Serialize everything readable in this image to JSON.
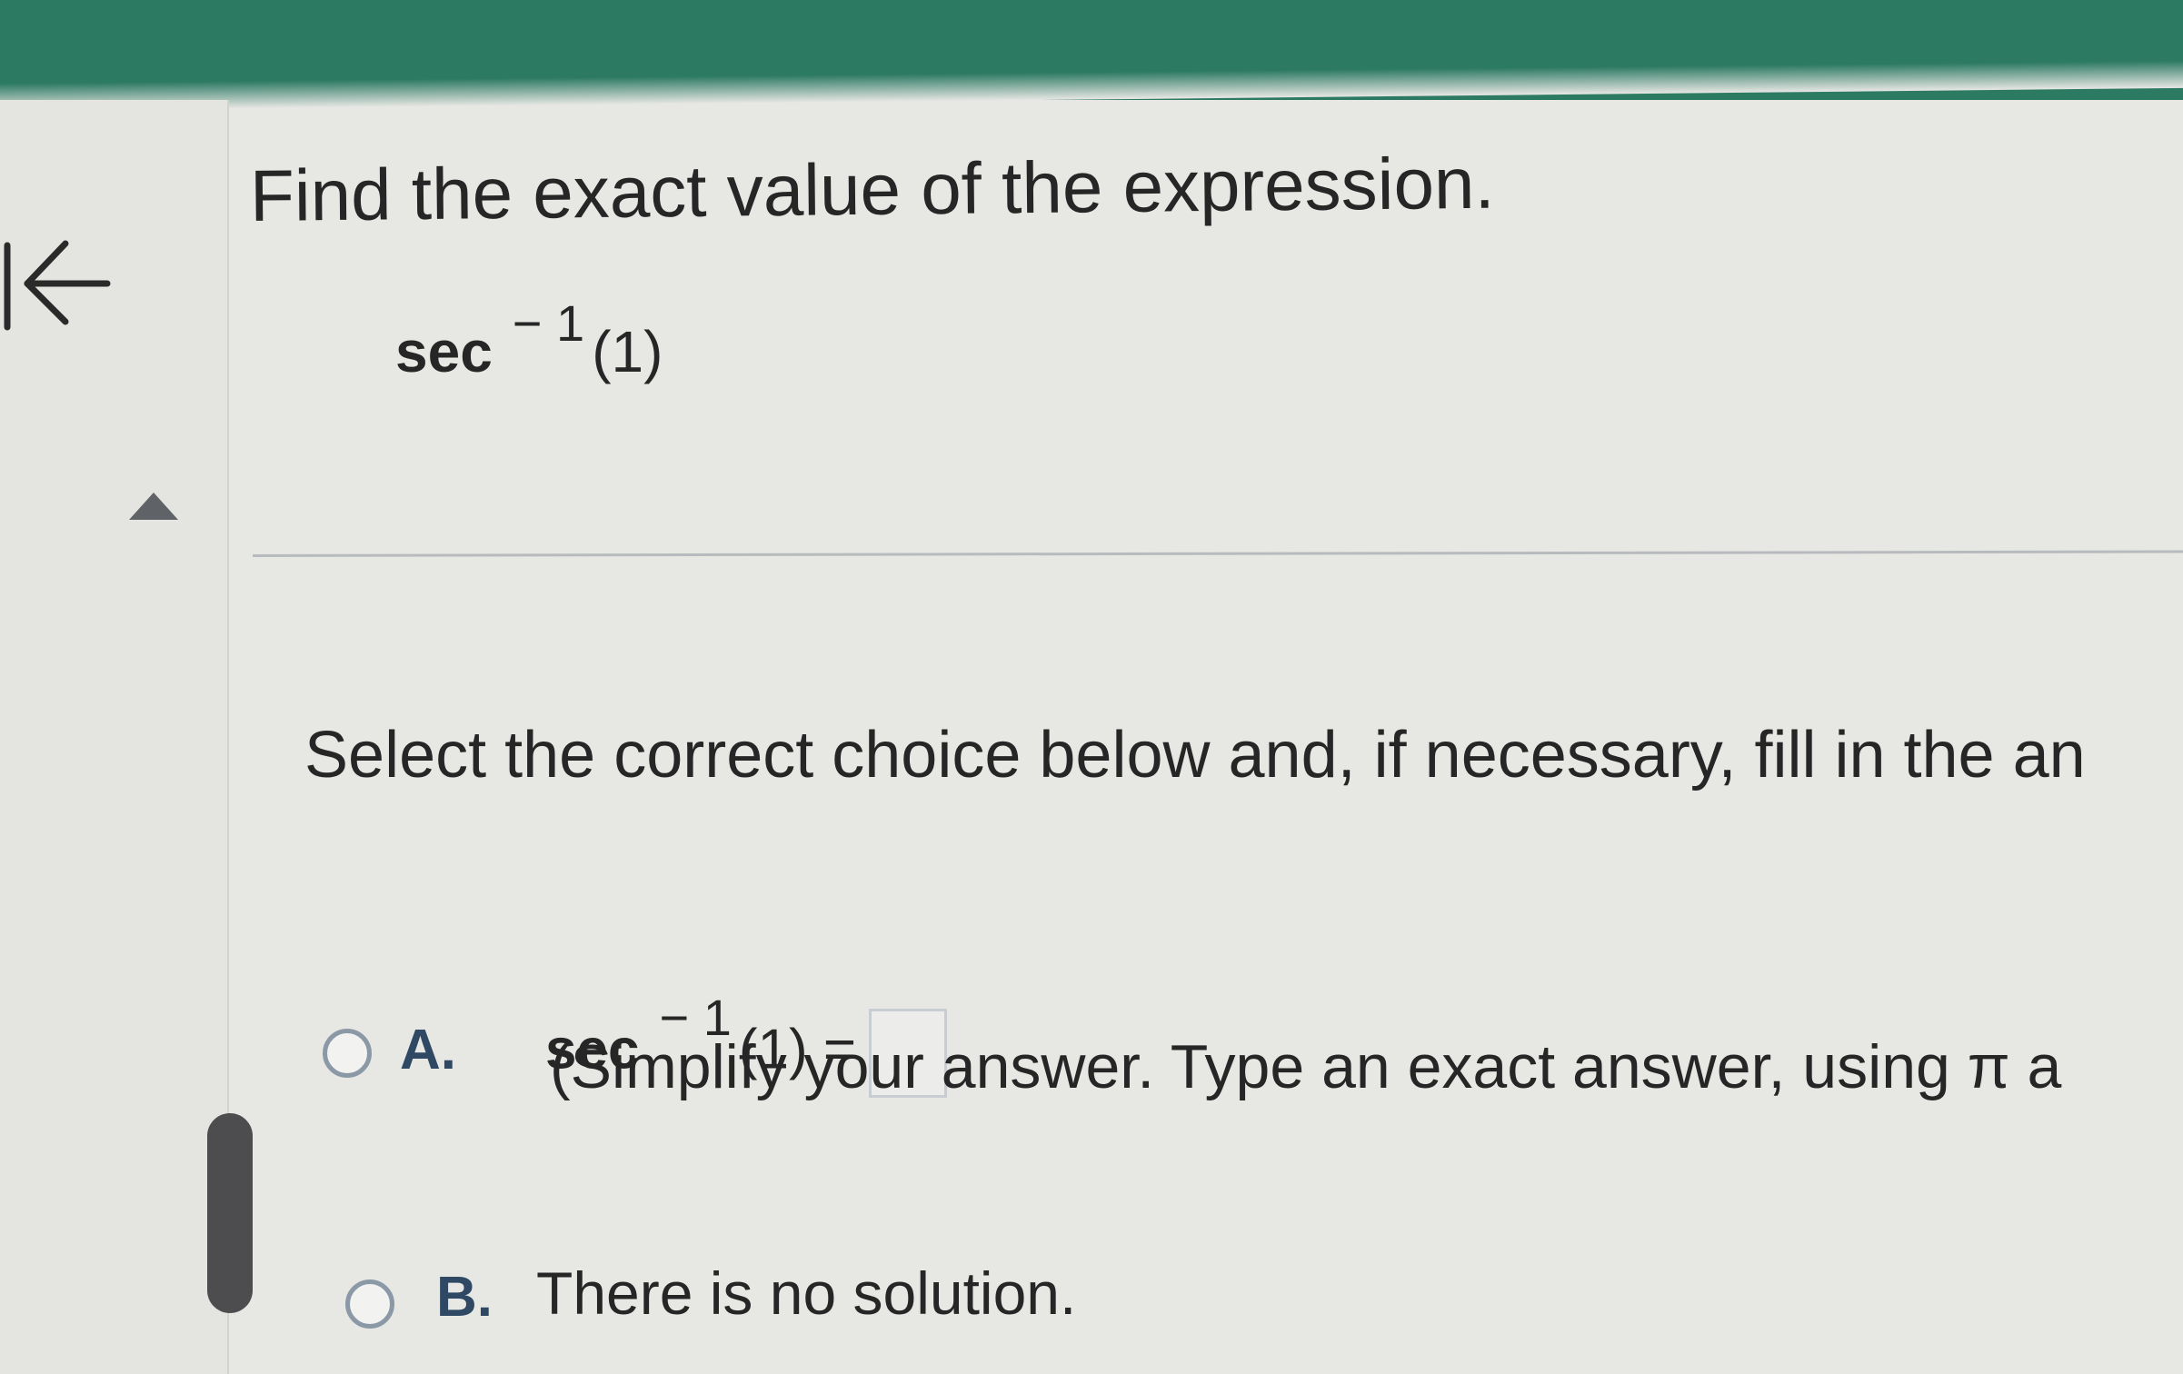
{
  "colors": {
    "top_bar": "#2d7a63",
    "radio_border": "#8b98a6",
    "choice_letter": "#2f4964",
    "scroll_handle": "#4d4d50"
  },
  "icons": {
    "back": "left-arrow-icon",
    "collapse": "triangle-up-icon"
  },
  "question": {
    "instruction": "Find the exact value of the expression.",
    "expression": {
      "function": "sec",
      "superscript": "− 1",
      "argument": "(1)"
    }
  },
  "answer_section": {
    "prompt": "Select the correct choice below and, if necessary, fill in the an",
    "choices": [
      {
        "letter": "A.",
        "function": "sec",
        "superscript": "− 1",
        "suffix": "(1) =",
        "input_value": "",
        "hint": "(Simplify your answer. Type an exact answer, using π a"
      },
      {
        "letter": "B.",
        "text": "There is no solution."
      }
    ]
  }
}
